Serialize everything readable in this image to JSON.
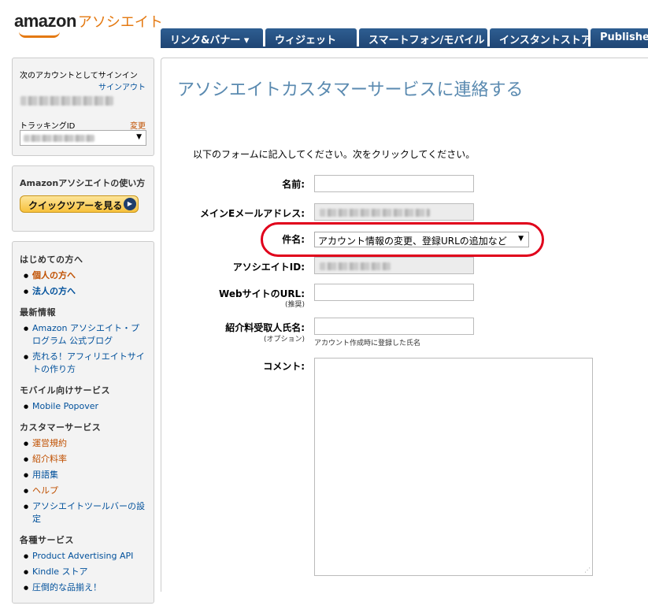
{
  "header": {
    "logo_text": "amazon",
    "logo_sub": "アソシエイト",
    "tabs": [
      "リンク&バナー ▾",
      "ウィジェット",
      "スマートフォン/モバイル",
      "インスタントストア",
      "Publisher"
    ]
  },
  "sidebar": {
    "signin_label": "次のアカウントとしてサインイン",
    "signout": "サインアウト",
    "tracking_label": "トラッキングID",
    "change": "変更",
    "howto_title": "Amazonアソシエイトの使い方",
    "tour_button": "クイックツアーを見る",
    "sections": [
      {
        "title": "はじめての方へ",
        "items": [
          "個人の方へ",
          "法人の方へ"
        ]
      },
      {
        "title": "最新情報",
        "items": [
          "Amazon アソシエイト・プログラム 公式ブログ",
          "売れる！アフィリエイトサイトの作り方"
        ]
      },
      {
        "title": "モバイル向けサービス",
        "items": [
          "Mobile Popover"
        ]
      },
      {
        "title": "カスタマーサービス",
        "items": [
          "運営規約",
          "紹介料率",
          "用語集",
          "ヘルプ",
          "アソシエイトツールバーの設定"
        ]
      },
      {
        "title": "各種サービス",
        "items": [
          "Product Advertising API",
          "Kindle ストア",
          "圧倒的な品揃え！"
        ]
      }
    ]
  },
  "main": {
    "title": "アソシエイトカスタマーサービスに連絡する",
    "intro": "以下のフォームに記入してください。次をクリックしてください。",
    "name_label": "名前:",
    "email_label": "メインEメールアドレス:",
    "subject_label": "件名:",
    "subject_value": "アカウント情報の変更、登録URLの追加など",
    "associate_id_label": "アソシエイトID:",
    "website_label": "WebサイトのURL:",
    "website_sub": "(推奨)",
    "payee_label": "紹介料受取人氏名:",
    "payee_sub": "(オプション)",
    "payee_hint": "アカウント作成時に登録した氏名",
    "comment_label": "コメント:"
  },
  "colors": {
    "tab_blue": "#1f4675",
    "title_blue": "#5a8ab0",
    "highlight_red": "#e0001b",
    "logo_orange": "#e47911"
  }
}
